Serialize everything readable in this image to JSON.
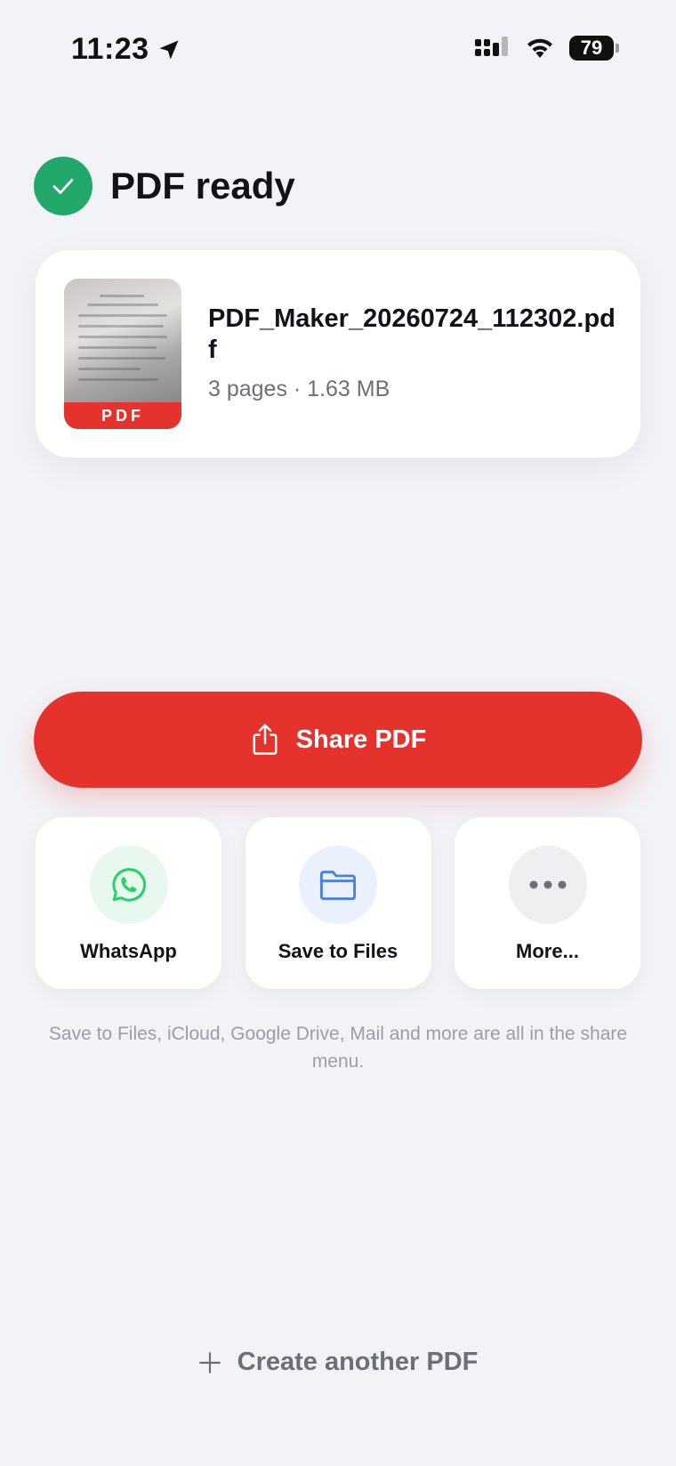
{
  "status_bar": {
    "time": "11:23",
    "battery": "79"
  },
  "header": {
    "title": "PDF ready"
  },
  "file": {
    "name": "PDF_Maker_20260724_112302.pdf",
    "meta": "3 pages · 1.63 MB",
    "badge": "PDF"
  },
  "actions": {
    "share_label": "Share PDF",
    "tiles": [
      {
        "label": "WhatsApp",
        "icon": "whatsapp-icon",
        "bg": "#e8f8ee",
        "color": "#25d366"
      },
      {
        "label": "Save to Files",
        "icon": "folder-icon",
        "bg": "#eaf0fc",
        "color": "#4a7fe0"
      },
      {
        "label": "More...",
        "icon": "more-icon",
        "bg": "#efeff1",
        "color": "#6b6f78"
      }
    ]
  },
  "helper_text": "Save to Files, iCloud, Google Drive, Mail and more are all in the share menu.",
  "footer": {
    "create_label": "Create another PDF"
  },
  "colors": {
    "accent": "#e5322d",
    "success": "#22a86a",
    "background": "#f2f3f7"
  }
}
